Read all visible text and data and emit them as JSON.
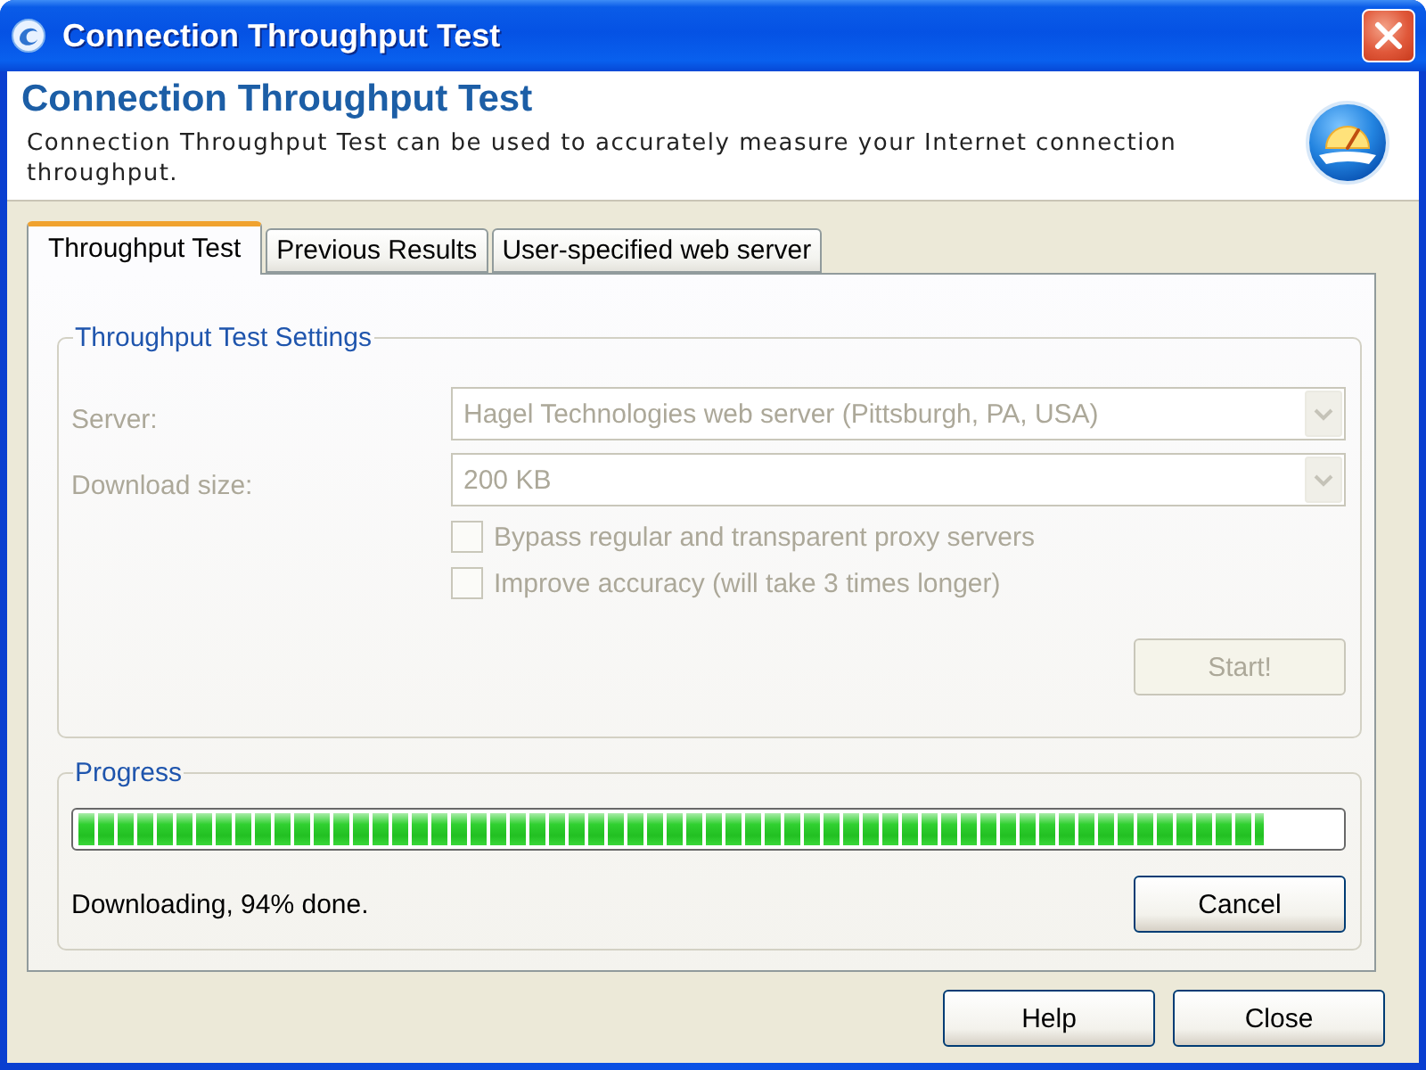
{
  "window": {
    "title": "Connection Throughput Test"
  },
  "header": {
    "title": "Connection Throughput Test",
    "description": "Connection Throughput Test can be used to accurately measure your Internet connection throughput."
  },
  "tabs": [
    {
      "label": "Throughput Test",
      "selected": true
    },
    {
      "label": "Previous Results",
      "selected": false
    },
    {
      "label": "User-specified web server",
      "selected": false
    }
  ],
  "settings": {
    "title": "Throughput Test Settings",
    "fields": [
      {
        "label": "Server:",
        "value": "Hagel Technologies web server (Pittsburgh, PA, USA)",
        "disabled": true
      },
      {
        "label": "Download size:",
        "value": "200 KB",
        "disabled": true
      }
    ],
    "options": [
      {
        "label": "Bypass regular and transparent proxy servers",
        "checked": false,
        "disabled": true
      },
      {
        "label": "Improve accuracy (will take 3 times longer)",
        "checked": false,
        "disabled": true
      }
    ],
    "start_button": {
      "label": "Start!",
      "disabled": true
    }
  },
  "progress": {
    "title": "Progress",
    "level": 0.94,
    "status": "Downloading, 94% done.",
    "cancel_button": {
      "label": "Cancel",
      "disabled": false
    }
  },
  "buttons": [
    {
      "label": "Help"
    },
    {
      "label": "Close"
    }
  ]
}
